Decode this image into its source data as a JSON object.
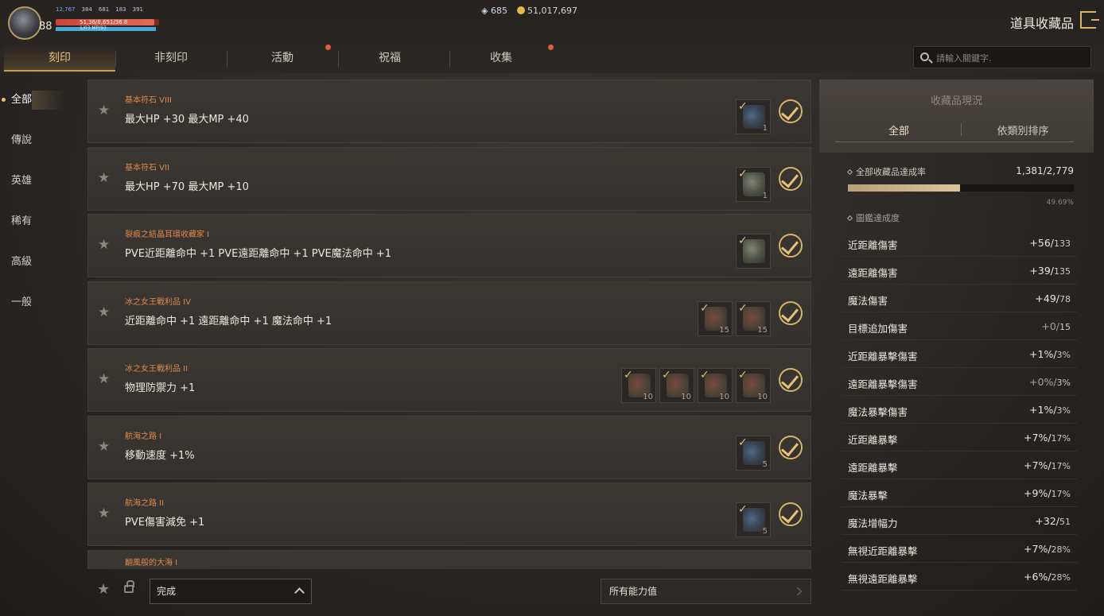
{
  "player": {
    "level": "88",
    "stats": [
      "12,767",
      "384",
      "681",
      "183",
      "391",
      ""
    ],
    "hp_text": "51,36/8,651/36 8",
    "mp_text": "1/03 MP/93"
  },
  "currency": {
    "gems": "685",
    "gold": "51,017,697"
  },
  "page_title": "道具收藏品",
  "tabs": [
    {
      "label": "刻印"
    },
    {
      "label": "非刻印"
    },
    {
      "label": "活動"
    },
    {
      "label": "祝福"
    },
    {
      "label": "收集"
    }
  ],
  "search": {
    "placeholder": "請輸入關鍵字."
  },
  "categories": [
    "全部",
    "傳說",
    "英雄",
    "稀有",
    "高級",
    "一般"
  ],
  "rows": [
    {
      "name": "基本符石 VIII",
      "effect": "最大HP +30 最大MP +40",
      "items": [
        {
          "qty": "1",
          "tone": "blue"
        }
      ]
    },
    {
      "name": "基本符石 VII",
      "effect": "最大HP +70 最大MP +10",
      "items": [
        {
          "qty": "1",
          "tone": "plain"
        }
      ]
    },
    {
      "name": "裂痕之結晶耳環收藏家 I",
      "effect": "PVE近距離命中 +1 PVE遠距離命中 +1 PVE魔法命中 +1",
      "items": [
        {
          "qty": "",
          "tone": "plain"
        }
      ]
    },
    {
      "name": "冰之女王戰利品 IV",
      "effect": "近距離命中 +1 遠距離命中 +1 魔法命中 +1",
      "items": [
        {
          "qty": "15",
          "tone": "red"
        },
        {
          "qty": "15",
          "tone": "red"
        }
      ]
    },
    {
      "name": "冰之女王戰利品 II",
      "effect": "物理防禦力 +1",
      "items": [
        {
          "qty": "10",
          "tone": "red"
        },
        {
          "qty": "10",
          "tone": "red"
        },
        {
          "qty": "10",
          "tone": "red"
        },
        {
          "qty": "10",
          "tone": "red"
        }
      ]
    },
    {
      "name": "航海之路 I",
      "effect": "移動速度 +1%",
      "items": [
        {
          "qty": "5",
          "tone": "blue"
        }
      ]
    },
    {
      "name": "航海之路 II",
      "effect": "PVE傷害減免 +1",
      "items": [
        {
          "qty": "5",
          "tone": "blue"
        }
      ]
    },
    {
      "name": "翻風般的大海 I",
      "effect": "",
      "items": []
    }
  ],
  "bottom": {
    "status_value": "完成",
    "ability_value": "所有能力值"
  },
  "panel": {
    "title": "收藏品現況",
    "tab_all": "全部",
    "tab_sort": "依類別排序",
    "rate_label": "全部收藏品達成率",
    "rate_value": "1,381/2,779",
    "rate_pct": "49.69%",
    "rate_fraction": 0.4969,
    "codex_label": "圖鑑達成度",
    "stats": [
      {
        "name": "近距離傷害",
        "value": "+56/",
        "max": "133"
      },
      {
        "name": "遠距離傷害",
        "value": "+39/",
        "max": "135"
      },
      {
        "name": "魔法傷害",
        "value": "+49/",
        "max": "78"
      },
      {
        "name": "目標追加傷害",
        "value": "+0/",
        "max": "15"
      },
      {
        "name": "近距離暴擊傷害",
        "value": "+1%/",
        "max": "3%"
      },
      {
        "name": "遠距離暴擊傷害",
        "value": "+0%/",
        "max": "3%"
      },
      {
        "name": "魔法暴擊傷害",
        "value": "+1%/",
        "max": "3%"
      },
      {
        "name": "近距離暴擊",
        "value": "+7%/",
        "max": "17%"
      },
      {
        "name": "遠距離暴擊",
        "value": "+7%/",
        "max": "17%"
      },
      {
        "name": "魔法暴擊",
        "value": "+9%/",
        "max": "17%"
      },
      {
        "name": "魔法增幅力",
        "value": "+32/",
        "max": "51"
      },
      {
        "name": "無視近距離暴擊",
        "value": "+7%/",
        "max": "28%"
      },
      {
        "name": "無視遠距離暴擊",
        "value": "+6%/",
        "max": "28%"
      }
    ]
  },
  "colors": {
    "accent": "#e6c27a",
    "row_name": "#e0894a",
    "hp": "#c8453a",
    "mp": "#48a9d8"
  }
}
